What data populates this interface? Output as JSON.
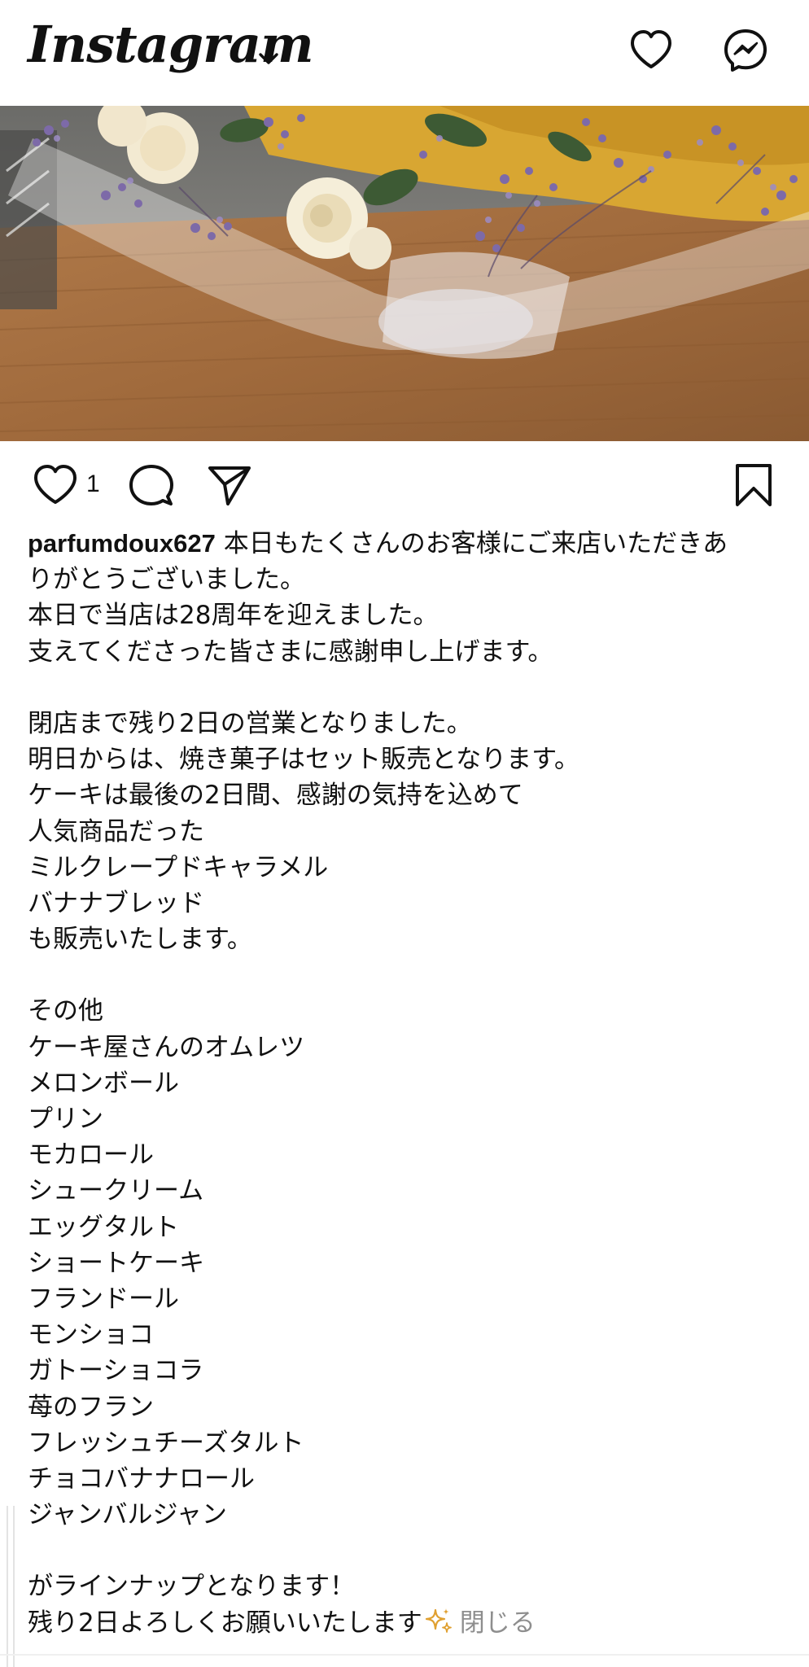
{
  "header": {
    "logo_text": "Instagram",
    "logo_dropdown_icon": "chevron-down-icon",
    "activity_icon": "heart-outline-icon",
    "messages_icon": "messenger-icon"
  },
  "post": {
    "image_subject": "bouquet-photo",
    "like_count": "1",
    "actions": {
      "like_icon": "heart-outline-icon",
      "comment_icon": "comment-bubble-icon",
      "share_icon": "paper-plane-icon",
      "save_icon": "bookmark-icon"
    },
    "caption": {
      "username": "parfumdoux627",
      "first_line_text": " 本日もたくさんのお客様にご来店いただきあ",
      "lines": [
        "りがとうございました。",
        "本日で当店は28周年を迎えました。",
        "支えてくださった皆さまに感謝申し上げます。",
        "",
        "閉店まで残り2日の営業となりました。",
        "明日からは、焼き菓子はセット販売となります。",
        "ケーキは最後の2日間、感謝の気持を込めて",
        "人気商品だった",
        "ミルクレープドキャラメル",
        "バナナブレッド",
        "も販売いたします。",
        "",
        "その他",
        "ケーキ屋さんのオムレツ",
        "メロンボール",
        "プリン",
        "モカロール",
        "シュークリーム",
        "エッグタルト",
        "ショートケーキ",
        "フランドール",
        "モンショコ",
        "ガトーショコラ",
        "苺のフラン",
        "フレッシュチーズタルト",
        "チョコバナナロール",
        "ジャンバルジャン",
        "",
        "がラインナップとなります！"
      ],
      "last_line_text": "残り2日よろしくお願いいたします",
      "sparkle_icon": "sparkles-icon",
      "close_label": "閉じる"
    }
  },
  "colors": {
    "text": "#111111",
    "muted": "#8e8e8e",
    "sparkle": "#e0a030",
    "background": "#ffffff"
  }
}
